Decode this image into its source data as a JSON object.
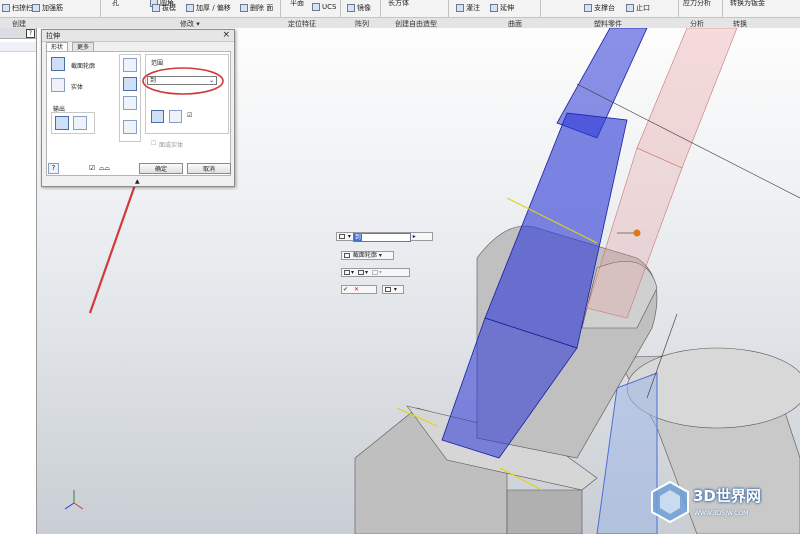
{
  "ribbon": {
    "items": [
      "扫掠扫描",
      "加强筋",
      "孔",
      "圆角",
      "拔模",
      "加厚 / 偏移",
      "删除 面",
      "平面",
      "UCS",
      "镜像",
      "长方体",
      "灌注",
      "延伸",
      "支撑台",
      "止口",
      "应力分析",
      "转换为钣金"
    ],
    "groups": [
      "创建",
      "修改 ▾",
      "定位特征",
      "阵列",
      "创建自由造型",
      "曲面",
      "塑料零件",
      "分析",
      "转换"
    ]
  },
  "browser": {
    "help_label": "?"
  },
  "dialog": {
    "title": "拉伸",
    "close_label": "×",
    "tabs": [
      "形状",
      "更多"
    ],
    "profile_label": "截面轮廓",
    "solid_label": "实体",
    "output_label": "输出",
    "extents_label": "范围",
    "extents_value": "到",
    "minimum_solution_label": "面或实体",
    "help_label": "?",
    "ok_label": "确定",
    "cancel_label": "取消"
  },
  "minitoolbar": {
    "extent_value": "到",
    "profile_label": "截面轮廓",
    "ok_symbol": "✔",
    "cancel_symbol": "✕"
  },
  "watermark": {
    "text": "3D世界网",
    "url": "WWW.3DSJW.COM"
  },
  "colors": {
    "annotation_red": "#d23a3a",
    "preview_blue": "#2b37d6",
    "preview_pink": "#e59a9a",
    "model_gray": "#c4c4c4"
  }
}
